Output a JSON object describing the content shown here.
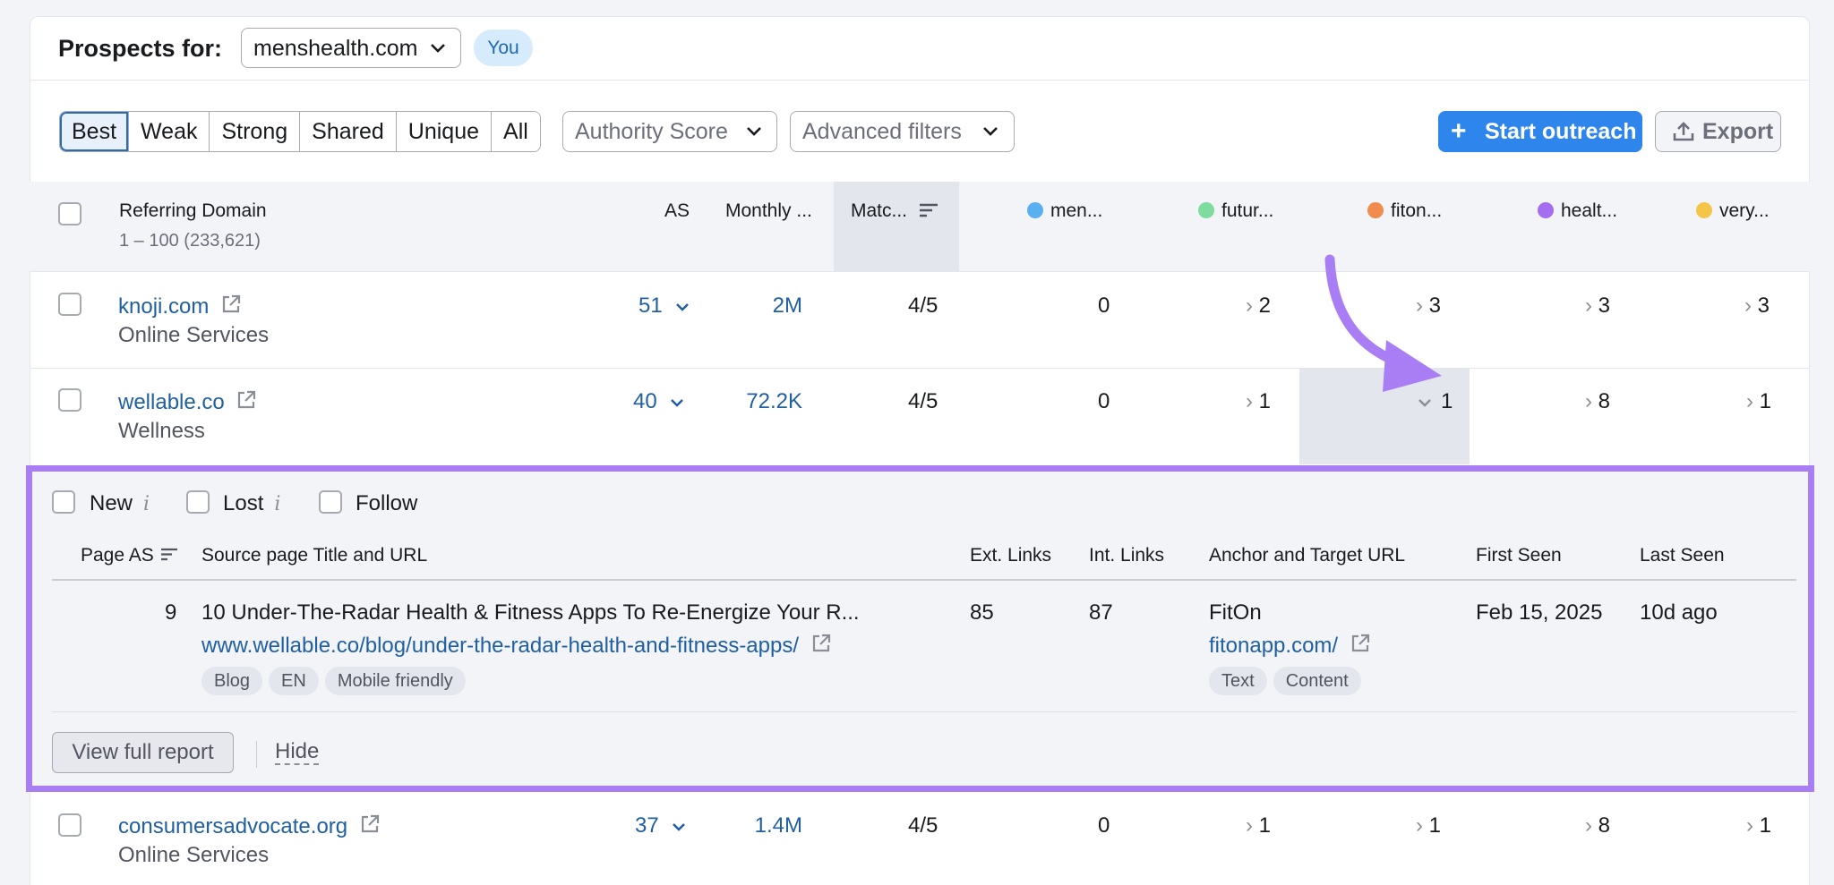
{
  "header": {
    "prospects_label": "Prospects for:",
    "domain": "menshealth.com",
    "badge": "You"
  },
  "filters": {
    "segments": [
      "Best",
      "Weak",
      "Strong",
      "Shared",
      "Unique",
      "All"
    ],
    "active_segment": "Best",
    "authority_score": "Authority Score",
    "advanced_filters": "Advanced filters",
    "start_outreach": "Start outreach",
    "export": "Export"
  },
  "table": {
    "columns": {
      "referring_domain": "Referring Domain",
      "range": "1 – 100 (233,621)",
      "as": "AS",
      "monthly": "Monthly ...",
      "match": "Matc...",
      "competitors": [
        {
          "name": "men...",
          "color": "#58b0f0"
        },
        {
          "name": "futur...",
          "color": "#7ddc9e"
        },
        {
          "name": "fiton...",
          "color": "#f08c4d"
        },
        {
          "name": "healt...",
          "color": "#a56ef0"
        },
        {
          "name": "very...",
          "color": "#f5c54a"
        }
      ]
    },
    "rows": [
      {
        "domain": "knoji.com",
        "category": "Online Services",
        "as": "51",
        "monthly": "2M",
        "match": "4/5",
        "c1": "0",
        "c2": "2",
        "c3": "3",
        "c4": "3",
        "c5": "3"
      },
      {
        "domain": "wellable.co",
        "category": "Wellness",
        "as": "40",
        "monthly": "72.2K",
        "match": "4/5",
        "c1": "0",
        "c2": "1",
        "c3": "1",
        "c4": "8",
        "c5": "1"
      },
      {
        "domain": "consumersadvocate.org",
        "category": "Online Services",
        "as": "37",
        "monthly": "1.4M",
        "match": "4/5",
        "c1": "0",
        "c2": "1",
        "c3": "1",
        "c4": "8",
        "c5": "1"
      }
    ]
  },
  "expanded": {
    "checkboxes": [
      "New",
      "Lost",
      "Follow"
    ],
    "info_icon": "i",
    "columns": {
      "page_as": "Page AS",
      "source": "Source page Title and URL",
      "ext": "Ext. Links",
      "int": "Int. Links",
      "anchor": "Anchor and Target URL",
      "first_seen": "First Seen",
      "last_seen": "Last Seen"
    },
    "row": {
      "page_as": "9",
      "title": "10 Under-The-Radar Health & Fitness Apps To Re-Energize Your R...",
      "url": "www.wellable.co/blog/under-the-radar-health-and-fitness-apps/",
      "tags": [
        "Blog",
        "EN",
        "Mobile friendly"
      ],
      "ext": "85",
      "int": "87",
      "anchor": "FitOn",
      "target_url": "fitonapp.com/",
      "anchor_tags": [
        "Text",
        "Content"
      ],
      "first_seen": "Feb 15, 2025",
      "last_seen": "10d ago"
    },
    "view_full_report": "View full report",
    "hide": "Hide"
  },
  "annotation": {
    "arrow_color": "#a97ef4"
  }
}
